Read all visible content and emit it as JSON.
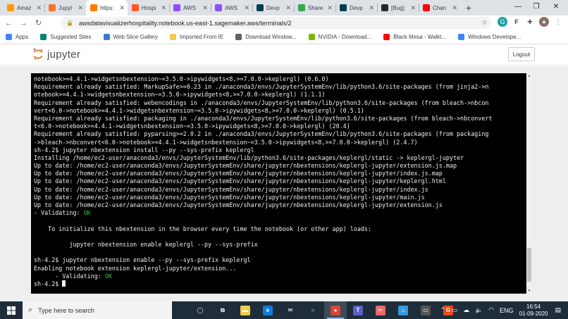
{
  "browser": {
    "tabs": [
      {
        "label": "Amaz",
        "favicon": "amazon-icon",
        "color": "#ff9900",
        "active": false
      },
      {
        "label": "Jupyt",
        "favicon": "jupyter-icon",
        "color": "#f37626",
        "active": false
      },
      {
        "label": "https:",
        "favicon": "terminal-icon",
        "color": "#ff7a00",
        "active": true
      },
      {
        "label": "Hospi",
        "favicon": "hospitality-icon",
        "color": "#ff5722",
        "active": false
      },
      {
        "label": "AWS",
        "favicon": "aws-icon",
        "color": "#8c4fff",
        "active": false
      },
      {
        "label": "AWS",
        "favicon": "aws-icon",
        "color": "#8c4fff",
        "active": false
      },
      {
        "label": "Devp",
        "favicon": "devpost-icon",
        "color": "#003e54",
        "active": false
      },
      {
        "label": "Share",
        "favicon": "share-icon",
        "color": "#34a853",
        "active": false
      },
      {
        "label": "Devp",
        "favicon": "devpost-icon",
        "color": "#003e54",
        "active": false
      },
      {
        "label": "[Bug]",
        "favicon": "github-icon",
        "color": "#24292e",
        "active": false
      },
      {
        "label": "Chan",
        "favicon": "youtube-icon",
        "color": "#ff0000",
        "active": false
      }
    ],
    "new_tab": "+",
    "address": "awsdatavisualizerhospitality.notebook.us-east-1.sagemaker.aws/terminals/2",
    "bookmarks": [
      {
        "label": "Apps",
        "icon": "apps-grid-icon",
        "color": "#4285f4"
      },
      {
        "label": "Suggested Sites",
        "icon": "bing-icon",
        "color": "#008373"
      },
      {
        "label": "Web Slice Gallery",
        "icon": "web-slice-icon",
        "color": "#3a7bd5"
      },
      {
        "label": "Imported From IE",
        "icon": "folder-icon",
        "color": "#f2c94c"
      },
      {
        "label": "Download Window...",
        "icon": "globe-icon",
        "color": "#5f6368"
      },
      {
        "label": "NVIDIA - Download...",
        "icon": "nvidia-icon",
        "color": "#76b900"
      },
      {
        "label": "Black Mesa - Walkt...",
        "icon": "youtube-icon",
        "color": "#ff0000"
      },
      {
        "label": "Windows Develope...",
        "icon": "google-icon",
        "color": "#4285f4"
      }
    ]
  },
  "jupyter": {
    "brand": "jupyter",
    "logout_label": "Logout"
  },
  "terminal": {
    "lines": [
      {
        "text": "notebook>=4.4.1->widgetsnbextension~=3.5.0->ipywidgets<8,>=7.0.0->keplergl) (0.6.0)"
      },
      {
        "text": "Requirement already satisfied: MarkupSafe>=0.23 in ./anaconda3/envs/JupyterSystemEnv/lib/python3.6/site-packages (from jinja2->n"
      },
      {
        "text": "otebook>=4.4.1->widgetsnbextension~=3.5.0->ipywidgets<8,>=7.0.0->keplergl) (1.1.1)"
      },
      {
        "text": "Requirement already satisfied: webencodings in ./anaconda3/envs/JupyterSystemEnv/lib/python3.6/site-packages (from bleach->nbcon"
      },
      {
        "text": "vert<6.0->notebook>=4.4.1->widgetsnbextension~=3.5.0->ipywidgets<8,>=7.0.0->keplergl) (0.5.1)"
      },
      {
        "text": "Requirement already satisfied: packaging in ./anaconda3/envs/JupyterSystemEnv/lib/python3.6/site-packages (from bleach->nbconvert"
      },
      {
        "text": "t<6.0->notebook>=4.4.1->widgetsnbextension~=3.5.0->ipywidgets<8,>=7.0.0->keplergl) (20.4)"
      },
      {
        "text": "Requirement already satisfied: pyparsing>=2.0.2 in ./anaconda3/envs/JupyterSystemEnv/lib/python3.6/site-packages (from packaging"
      },
      {
        "text": "->bleach->nbconvert<6.0->notebook>=4.4.1->widgetsnbextension~=3.5.0->ipywidgets<8,>=7.0.0->keplergl) (2.4.7)"
      },
      {
        "text": "sh-4.2$ jupyter nbextension install --py --sys-prefix keplergl"
      },
      {
        "text": "Installing /home/ec2-user/anaconda3/envs/JupyterSystemEnv/lib/python3.6/site-packages/keplergl/static -> keplergl-jupyter"
      },
      {
        "text": "Up to date: /home/ec2-user/anaconda3/envs/JupyterSystemEnv/share/jupyter/nbextensions/keplergl-jupyter/extension.js.map"
      },
      {
        "text": "Up to date: /home/ec2-user/anaconda3/envs/JupyterSystemEnv/share/jupyter/nbextensions/keplergl-jupyter/index.js.map"
      },
      {
        "text": "Up to date: /home/ec2-user/anaconda3/envs/JupyterSystemEnv/share/jupyter/nbextensions/keplergl-jupyter/keplergl.html"
      },
      {
        "text": "Up to date: /home/ec2-user/anaconda3/envs/JupyterSystemEnv/share/jupyter/nbextensions/keplergl-jupyter/index.js"
      },
      {
        "text": "Up to date: /home/ec2-user/anaconda3/envs/JupyterSystemEnv/share/jupyter/nbextensions/keplergl-jupyter/main.js"
      },
      {
        "text": "Up to date: /home/ec2-user/anaconda3/envs/JupyterSystemEnv/share/jupyter/nbextensions/keplergl-jupyter/extension.js"
      },
      {
        "text": "- Validating: ",
        "ok": "OK"
      },
      {
        "text": ""
      },
      {
        "text": "    To initialize this nbextension in the browser every time the notebook (or other app) loads:"
      },
      {
        "text": ""
      },
      {
        "text": "          jupyter nbextension enable keplergl --py --sys-prefix"
      },
      {
        "text": ""
      },
      {
        "text": "sh-4.2$ jupyter nbextension enable --py --sys-prefix keplergl"
      },
      {
        "text": "Enabling notebook extension keplergl-jupyter/extension..."
      },
      {
        "text": "      - Validating: ",
        "ok": "OK"
      },
      {
        "text": "sh-4.2$ ",
        "cursor": true
      }
    ],
    "ok_color": "#2fc12f"
  },
  "taskbar": {
    "search_placeholder": "Type here to search",
    "apps": [
      {
        "name": "task-view-icon",
        "glyph": "◯",
        "color": "transparent"
      },
      {
        "name": "timeline-icon",
        "glyph": "⧉",
        "color": "transparent"
      },
      {
        "name": "file-explorer-icon",
        "glyph": "▬",
        "color": "#f2c94c"
      },
      {
        "name": "edge-icon",
        "glyph": "e",
        "color": "#0f7bd8"
      },
      {
        "name": "mail-icon",
        "glyph": "✉",
        "color": "transparent"
      },
      {
        "name": "cortana-icon",
        "glyph": "○",
        "color": "transparent"
      },
      {
        "name": "chrome-icon",
        "glyph": "●",
        "color": "#db4437",
        "active": true
      },
      {
        "name": "teams-icon",
        "glyph": "T",
        "color": "#5b5fc7"
      },
      {
        "name": "snip-icon",
        "glyph": "✂",
        "color": "#e66b6b"
      },
      {
        "name": "store-icon",
        "glyph": "⌂",
        "color": "#3a96dd"
      },
      {
        "name": "screen-icon",
        "glyph": "▭",
        "color": "#555555"
      },
      {
        "name": "app-icon",
        "glyph": "G",
        "color": "#e64a19"
      }
    ],
    "language": "ENG",
    "time": "16:54",
    "date": "01-09-2020"
  }
}
